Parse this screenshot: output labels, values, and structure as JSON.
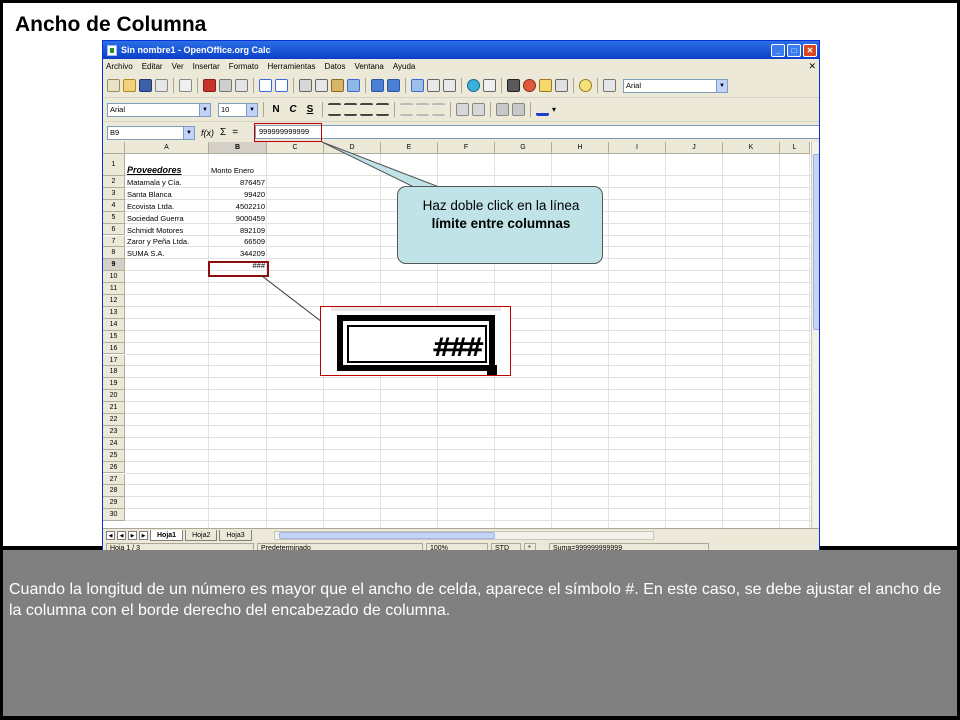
{
  "slide": {
    "title": "Ancho de Columna",
    "caption": "Cuando la longitud de un número es mayor que el ancho de celda, aparece el símbolo #. En este caso, se debe ajustar el ancho de la columna con el borde derecho del encabezado de columna."
  },
  "window": {
    "title": "Sin nombre1 - OpenOffice.org Calc",
    "buttons": {
      "minimize": "_",
      "maximize": "□",
      "close": "✕"
    }
  },
  "menubar": {
    "items": [
      "Archivo",
      "Editar",
      "Ver",
      "Insertar",
      "Formato",
      "Herramientas",
      "Datos",
      "Ventana",
      "Ayuda"
    ],
    "close": "✕"
  },
  "toolbar": {
    "font_name_right": "Arial"
  },
  "format_toolbar": {
    "font_name": "Arial",
    "font_size": "10",
    "bold": "N",
    "italic": "C",
    "underline": "S"
  },
  "formula_bar": {
    "name_box": "B9",
    "function_wizard": "f(x)",
    "sum": "Σ",
    "equals": "=",
    "input": "999999999999"
  },
  "grid": {
    "columns": [
      "A",
      "B",
      "C",
      "D",
      "E",
      "F",
      "G",
      "H",
      "I",
      "J",
      "K",
      "L"
    ],
    "rows": [
      "1",
      "2",
      "3",
      "4",
      "5",
      "6",
      "7",
      "8",
      "9",
      "10",
      "11",
      "12",
      "13",
      "14",
      "15",
      "16",
      "17",
      "18",
      "19",
      "20",
      "21",
      "22",
      "23",
      "24",
      "25",
      "26",
      "27",
      "28",
      "29",
      "30"
    ],
    "header_a": "Proveedores",
    "header_b": "Monto Enero",
    "data": [
      {
        "name": "Matamala y Cía.",
        "amount": "876457"
      },
      {
        "name": "Santa Blanca",
        "amount": "99420"
      },
      {
        "name": "Ecovista Ltda.",
        "amount": "4502210"
      },
      {
        "name": "Sociedad Guerra",
        "amount": "9000459"
      },
      {
        "name": "Schmidt Motores",
        "amount": "892109"
      },
      {
        "name": "Zaror y Peña Ltda.",
        "amount": "66509"
      },
      {
        "name": "SUMA S.A.",
        "amount": "344209"
      }
    ],
    "overflow_cell": "###"
  },
  "sheets": {
    "tabs": [
      "Hoja1",
      "Hoja2",
      "Hoja3"
    ],
    "active": "Hoja1"
  },
  "statusbar": {
    "sheet": "Hoja 1 / 3",
    "style": "Predeterminado",
    "zoom": "100%",
    "mode": "STD",
    "modified": "*",
    "sum": "Suma=999999999999"
  },
  "callout": {
    "text_prefix": "Haz doble click en la línea ",
    "text_bold": "límite entre columnas"
  },
  "colors": {
    "highlight": "#c00000",
    "callout_bg": "#bfe3e6",
    "bottom_bg": "#808080"
  }
}
